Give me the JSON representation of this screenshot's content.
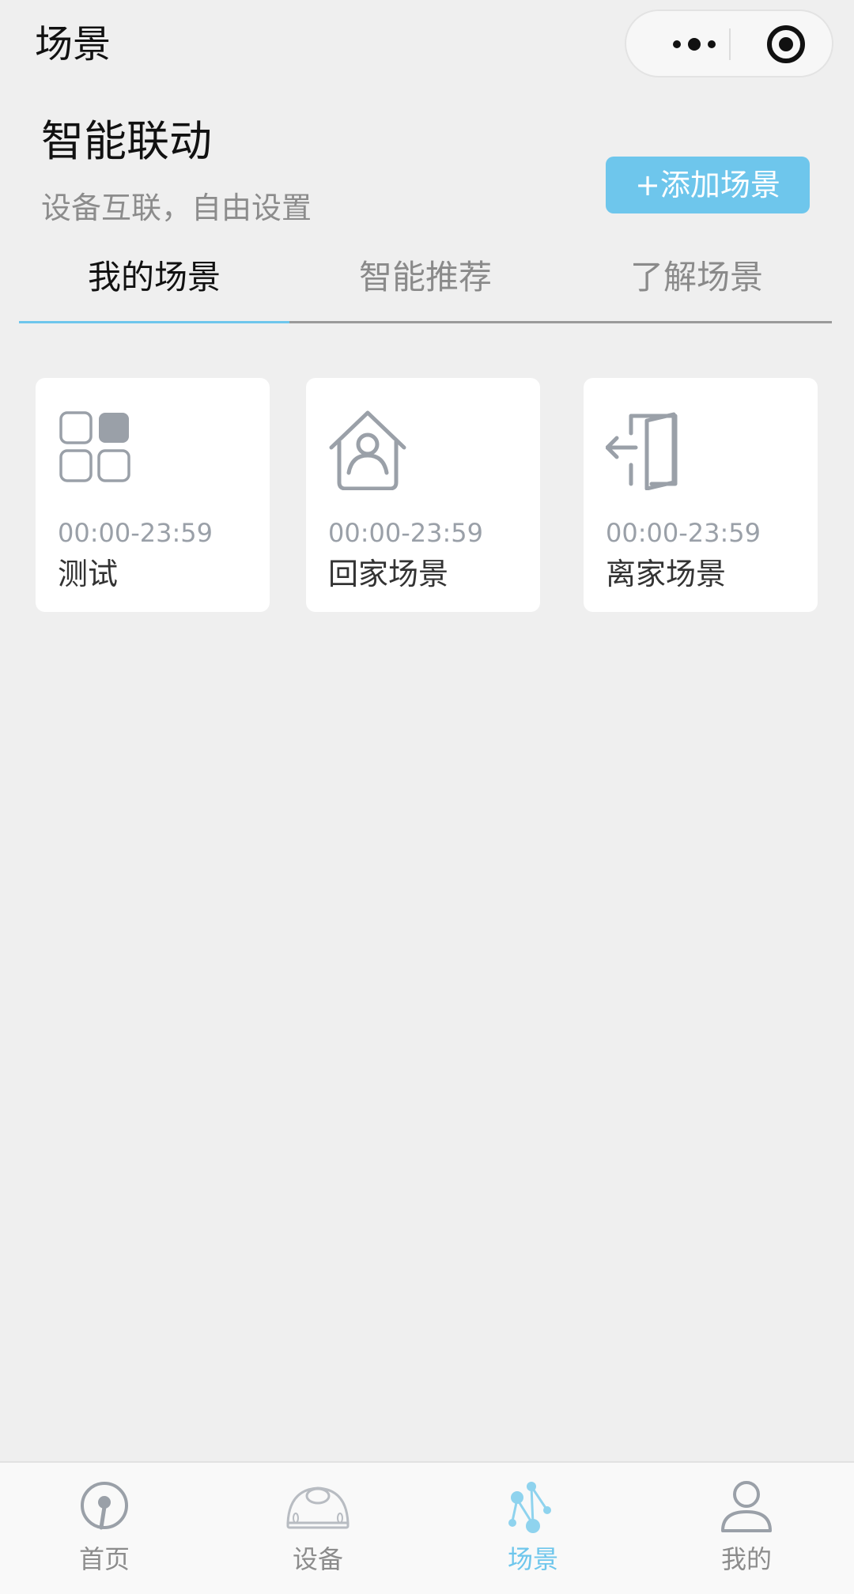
{
  "topbar": {
    "title": "场景",
    "more_icon": "more-dots-icon",
    "target_icon": "target-icon"
  },
  "header": {
    "title": "智能联动",
    "subtitle": "设备互联，自由设置",
    "add_button": "+添加场景"
  },
  "tabs": [
    {
      "label": "我的场景",
      "active": true
    },
    {
      "label": "智能推荐",
      "active": false
    },
    {
      "label": "了解场景",
      "active": false
    }
  ],
  "cards": [
    {
      "time": "00:00-23:59",
      "name": "测试",
      "icon": "grid-apps-icon"
    },
    {
      "time": "00:00-23:59",
      "name": "回家场景",
      "icon": "home-person-icon"
    },
    {
      "time": "00:00-23:59",
      "name": "离家场景",
      "icon": "door-exit-icon"
    }
  ],
  "tabbar": [
    {
      "label": "首页",
      "icon": "home-icon",
      "active": false
    },
    {
      "label": "设备",
      "icon": "device-dome-icon",
      "active": false
    },
    {
      "label": "场景",
      "icon": "scene-network-icon",
      "active": true
    },
    {
      "label": "我的",
      "icon": "user-icon",
      "active": false
    }
  ],
  "colors": {
    "accent": "#6ec6ec",
    "background": "#efefef",
    "icon_gray": "#9aa0a8"
  }
}
